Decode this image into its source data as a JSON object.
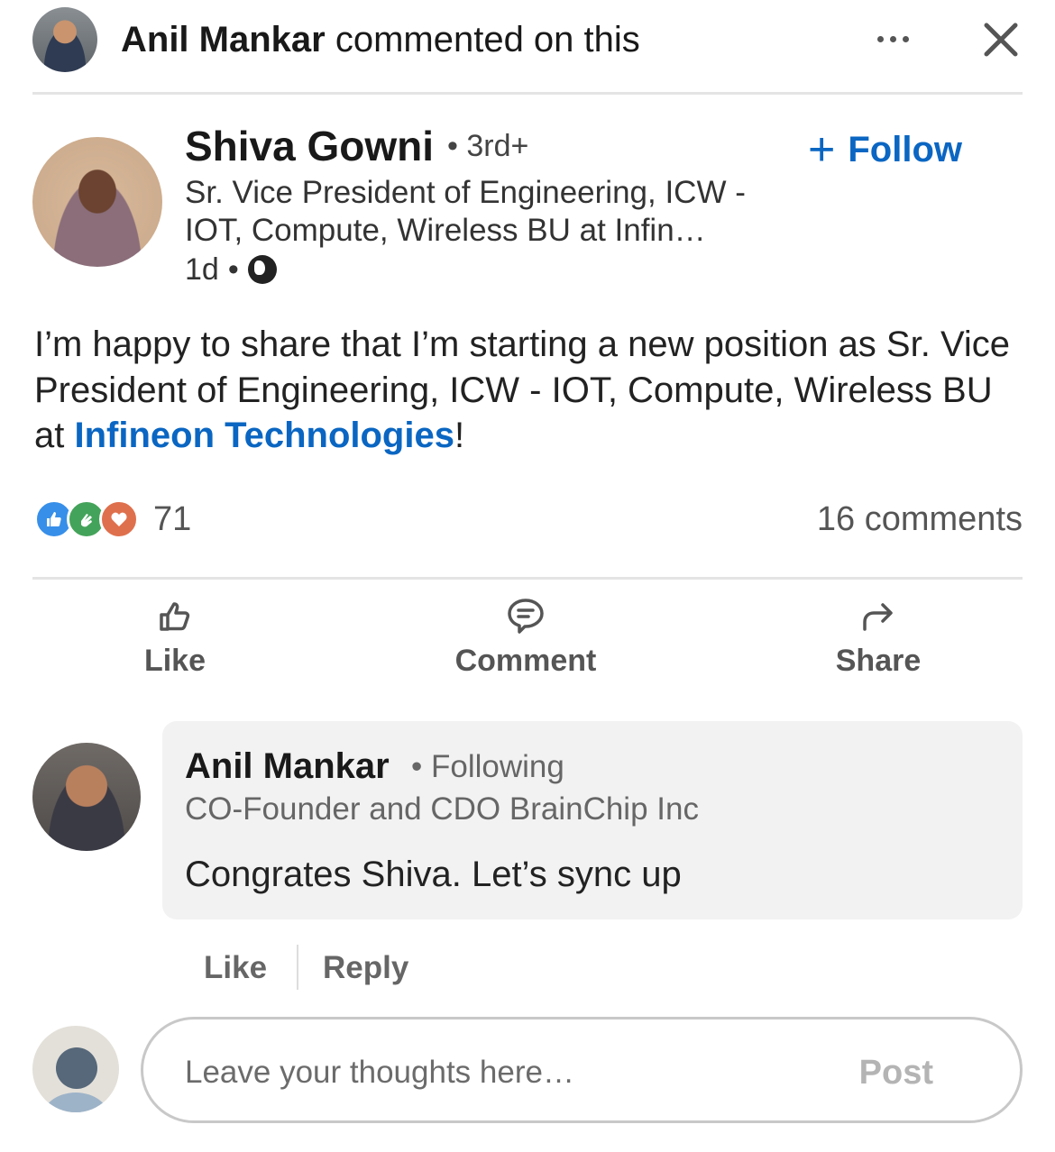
{
  "header": {
    "actor_name": "Anil Mankar",
    "actor_action": " commented on this"
  },
  "post": {
    "author_name": "Shiva Gowni",
    "author_degree": "• 3rd+",
    "author_headline": "Sr. Vice President of Engineering, ICW - IOT, Compute, Wireless BU at Infin…",
    "time": "1d",
    "time_sep": "•",
    "visibility_icon": "globe-icon",
    "follow_plus": "+",
    "follow_label": "Follow",
    "text_before": "I’m happy to share that I’m starting a new position as Sr. Vice President of Engineering, ICW - IOT, Compute, Wireless BU at ",
    "text_link": "Infineon Technologies",
    "text_after": "!",
    "reaction_count": "71",
    "comments_count": "16 comments",
    "reaction_icons": [
      "like-reaction-icon",
      "celebrate-reaction-icon",
      "love-reaction-icon"
    ]
  },
  "actions": {
    "like": "Like",
    "comment": "Comment",
    "share": "Share"
  },
  "comment": {
    "author_name": "Anil Mankar",
    "following": "• Following",
    "headline": "CO-Founder and CDO BrainChip Inc",
    "text": "Congrates Shiva. Let’s sync up",
    "like": "Like",
    "reply": "Reply"
  },
  "composer": {
    "placeholder": "Leave your thoughts here…",
    "post_label": "Post"
  },
  "colors": {
    "link_blue": "#0a66c2",
    "like_blue": "#378fe9",
    "celebrate_green": "#44a35a",
    "love_orange": "#df704d"
  }
}
